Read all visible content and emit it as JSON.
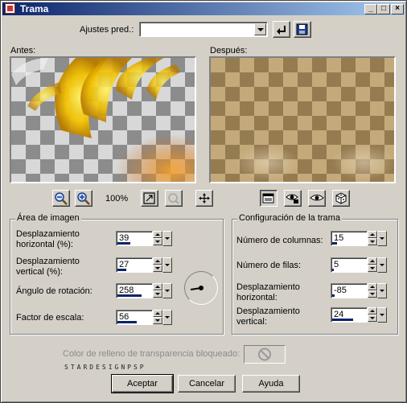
{
  "window": {
    "title": "Trama"
  },
  "presets": {
    "label": "Ajustes pred.:",
    "value": ""
  },
  "previews": {
    "before_label": "Antes:",
    "after_label": "Después:"
  },
  "zoom": {
    "level": "100%"
  },
  "area": {
    "title": "Área de imagen",
    "fields": [
      {
        "label_line1": "Desplazamiento",
        "label_line2": "horizontal (%):",
        "value": "39",
        "fill": 0.39
      },
      {
        "label_line1": "Desplazamiento",
        "label_line2": "vertical (%):",
        "value": "27",
        "fill": 0.27
      },
      {
        "label_line1": "Ángulo de rotación:",
        "label_line2": "",
        "value": "258",
        "fill": 0.72
      },
      {
        "label_line1": "Factor de escala:",
        "label_line2": "",
        "value": "56",
        "fill": 0.56
      }
    ]
  },
  "config": {
    "title": "Configuración de la trama",
    "fields": [
      {
        "label_line1": "Número de columnas:",
        "label_line2": "",
        "value": "15",
        "fill": 0.15
      },
      {
        "label_line1": "Número de filas:",
        "label_line2": "",
        "value": "5",
        "fill": 0.05
      },
      {
        "label_line1": "Desplazamiento",
        "label_line2": "horizontal:",
        "value": "-85",
        "fill": 0.08
      },
      {
        "label_line1": "Desplazamiento",
        "label_line2": "vertical:",
        "value": "24",
        "fill": 0.62
      }
    ]
  },
  "transparency": {
    "label": "Color de relleno de transparencia bloqueado:"
  },
  "watermark": "STARDESIGNPSP",
  "buttons": {
    "ok": "Aceptar",
    "cancel": "Cancelar",
    "help": "Ayuda"
  },
  "colors": {
    "title_start": "#0a246a",
    "title_end": "#a6caf0",
    "face": "#d4d0c8",
    "bar": "#0a246a"
  }
}
